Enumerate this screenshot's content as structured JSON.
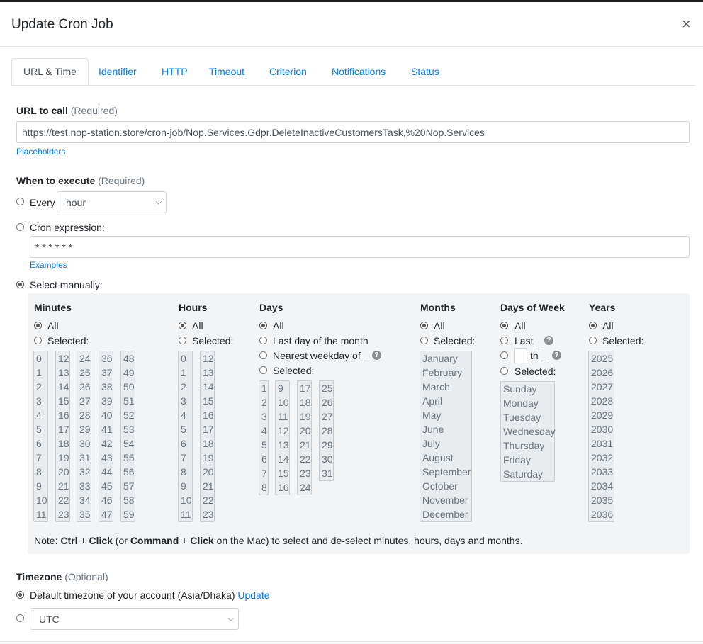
{
  "modal": {
    "title": "Update Cron Job",
    "close_glyph": "×"
  },
  "tabs": [
    {
      "label": "URL & Time",
      "active": true
    },
    {
      "label": "Identifier"
    },
    {
      "label": "HTTP"
    },
    {
      "label": "Timeout"
    },
    {
      "label": "Criterion"
    },
    {
      "label": "Notifications"
    },
    {
      "label": "Status"
    }
  ],
  "url": {
    "label": "URL to call",
    "required": "(Required)",
    "value": "https://test.nop-station.store/cron-job/Nop.Services.Gdpr.DeleteInactiveCustomersTask,%20Nop.Services",
    "placeholders_link": "Placeholders"
  },
  "execute": {
    "label": "When to execute",
    "required": "(Required)",
    "every_label": "Every",
    "every_value": "hour",
    "cron_label": "Cron expression:",
    "cron_value": "* * * * * *",
    "examples_link": "Examples",
    "manual_label": "Select manually:"
  },
  "manual": {
    "minutes": {
      "title": "Minutes",
      "all": "All",
      "selected": "Selected:",
      "values": [
        "0",
        "1",
        "2",
        "3",
        "4",
        "5",
        "6",
        "7",
        "8",
        "9",
        "10",
        "11",
        "12",
        "13",
        "14",
        "15",
        "16",
        "17",
        "18",
        "19",
        "20",
        "21",
        "22",
        "23",
        "24",
        "25",
        "26",
        "27",
        "28",
        "29",
        "30",
        "31",
        "32",
        "33",
        "34",
        "35",
        "36",
        "37",
        "38",
        "39",
        "40",
        "41",
        "42",
        "43",
        "44",
        "45",
        "46",
        "47",
        "48",
        "49",
        "50",
        "51",
        "52",
        "53",
        "54",
        "55",
        "56",
        "57",
        "58",
        "59"
      ]
    },
    "hours": {
      "title": "Hours",
      "all": "All",
      "selected": "Selected:",
      "values": [
        "0",
        "1",
        "2",
        "3",
        "4",
        "5",
        "6",
        "7",
        "8",
        "9",
        "10",
        "11",
        "12",
        "13",
        "14",
        "15",
        "16",
        "17",
        "18",
        "19",
        "20",
        "21",
        "22",
        "23"
      ]
    },
    "days": {
      "title": "Days",
      "all": "All",
      "last_day": "Last day of the month",
      "nearest": "Nearest weekday of _",
      "selected": "Selected:",
      "values": [
        "1",
        "2",
        "3",
        "4",
        "5",
        "6",
        "7",
        "8",
        "9",
        "10",
        "11",
        "12",
        "13",
        "14",
        "15",
        "16",
        "17",
        "18",
        "19",
        "20",
        "21",
        "22",
        "23",
        "24",
        "25",
        "26",
        "27",
        "28",
        "29",
        "30",
        "31"
      ]
    },
    "months": {
      "title": "Months",
      "all": "All",
      "selected": "Selected:",
      "values": [
        "January",
        "February",
        "March",
        "April",
        "May",
        "June",
        "July",
        "August",
        "September",
        "October",
        "November",
        "December"
      ]
    },
    "weekdays": {
      "title": "Days of Week",
      "all": "All",
      "last": "Last _",
      "nth": "th _",
      "selected": "Selected:",
      "values": [
        "Sunday",
        "Monday",
        "Tuesday",
        "Wednesday",
        "Thursday",
        "Friday",
        "Saturday"
      ]
    },
    "years": {
      "title": "Years",
      "all": "All",
      "selected": "Selected:",
      "values": [
        "2025",
        "2026",
        "2027",
        "2028",
        "2029",
        "2030",
        "2031",
        "2032",
        "2033",
        "2034",
        "2035",
        "2036"
      ]
    },
    "note": {
      "prefix": "Note: ",
      "ctrl": "Ctrl",
      "plus1": " + ",
      "click1": "Click",
      "mid": " (or ",
      "command": "Command",
      "plus2": " + ",
      "click2": "Click",
      "suffix": " on the Mac) to select and de-select minutes, hours, days and months."
    }
  },
  "timezone": {
    "label": "Timezone",
    "optional": "(Optional)",
    "default_text": "Default timezone of your account (Asia/Dhaka)",
    "update_link": "Update",
    "select_value": "UTC"
  }
}
